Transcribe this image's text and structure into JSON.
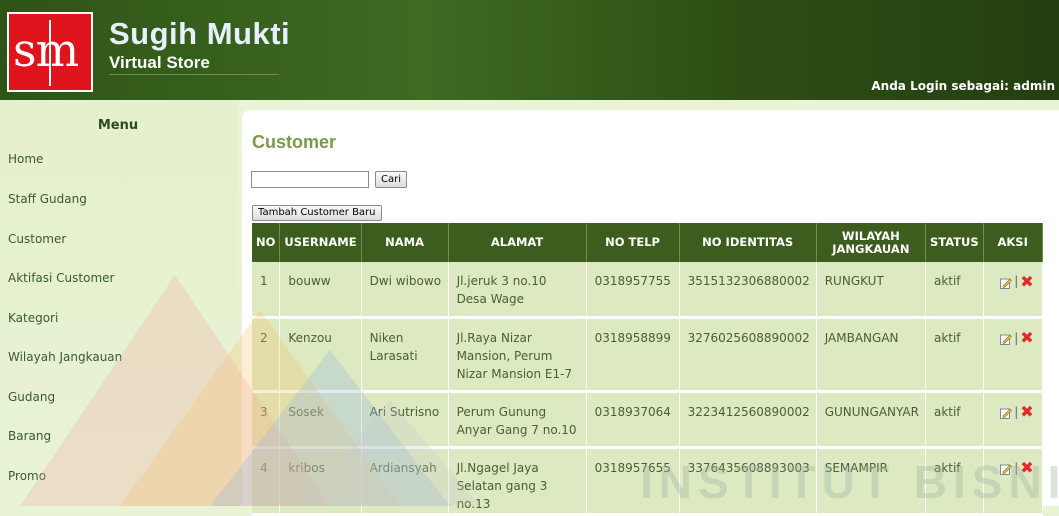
{
  "header": {
    "logo_text": "sm",
    "brand_name": "Sugih Mukti",
    "brand_sub": "Virtual Store",
    "login_info": "Anda Login sebagai: admin"
  },
  "sidebar": {
    "title": "Menu",
    "items": [
      {
        "label": "Home"
      },
      {
        "label": "Staff Gudang"
      },
      {
        "label": "Customer"
      },
      {
        "label": "Aktifasi Customer"
      },
      {
        "label": "Kategori"
      },
      {
        "label": "Wilayah Jangkauan"
      },
      {
        "label": "Gudang"
      },
      {
        "label": "Barang"
      },
      {
        "label": "Promo"
      }
    ]
  },
  "main": {
    "title": "Customer",
    "search_value": "",
    "search_button": "Cari",
    "add_button": "Tambah Customer Baru"
  },
  "table": {
    "headers": [
      "NO",
      "USERNAME",
      "NAMA",
      "ALAMAT",
      "NO TELP",
      "NO IDENTITAS",
      "WILAYAH JANGKAUAN",
      "STATUS",
      "AKSI"
    ],
    "rows": [
      {
        "no": "1",
        "username": "bouww",
        "nama": "Dwi wibowo",
        "alamat": "Jl.jeruk 3 no.10 Desa Wage",
        "telp": "0318957755",
        "identitas": "3515132306880002",
        "wilayah": "RUNGKUT",
        "status": "aktif"
      },
      {
        "no": "2",
        "username": "Kenzou",
        "nama": "Niken Larasati",
        "alamat": "Jl.Raya Nizar Mansion, Perum Nizar Mansion E1-7",
        "telp": "0318958899",
        "identitas": "3276025608890002",
        "wilayah": "JAMBANGAN",
        "status": "aktif"
      },
      {
        "no": "3",
        "username": "Sosek",
        "nama": "Ari Sutrisno",
        "alamat": "Perum Gunung Anyar Gang 7 no.10",
        "telp": "0318937064",
        "identitas": "3223412560890002",
        "wilayah": "GUNUNGANYAR",
        "status": "aktif"
      },
      {
        "no": "4",
        "username": "kribos",
        "nama": "Ardiansyah",
        "alamat": "Jl.Ngagel Jaya Selatan gang 3 no.13",
        "telp": "0318957655",
        "identitas": "3376435608893003",
        "wilayah": "SEMAMPIR",
        "status": "aktif"
      }
    ],
    "action_separator": "|"
  },
  "watermark": {
    "text": "INSTITUT BISNIS"
  },
  "icons": {
    "edit": "edit-icon",
    "delete": "delete-icon"
  },
  "colors": {
    "header_green": "#3f6a22",
    "table_header": "#3c5d1d",
    "row_bg": "#dde9c0",
    "title_green": "#7a9a4a",
    "delete_red": "#e32b2b"
  }
}
